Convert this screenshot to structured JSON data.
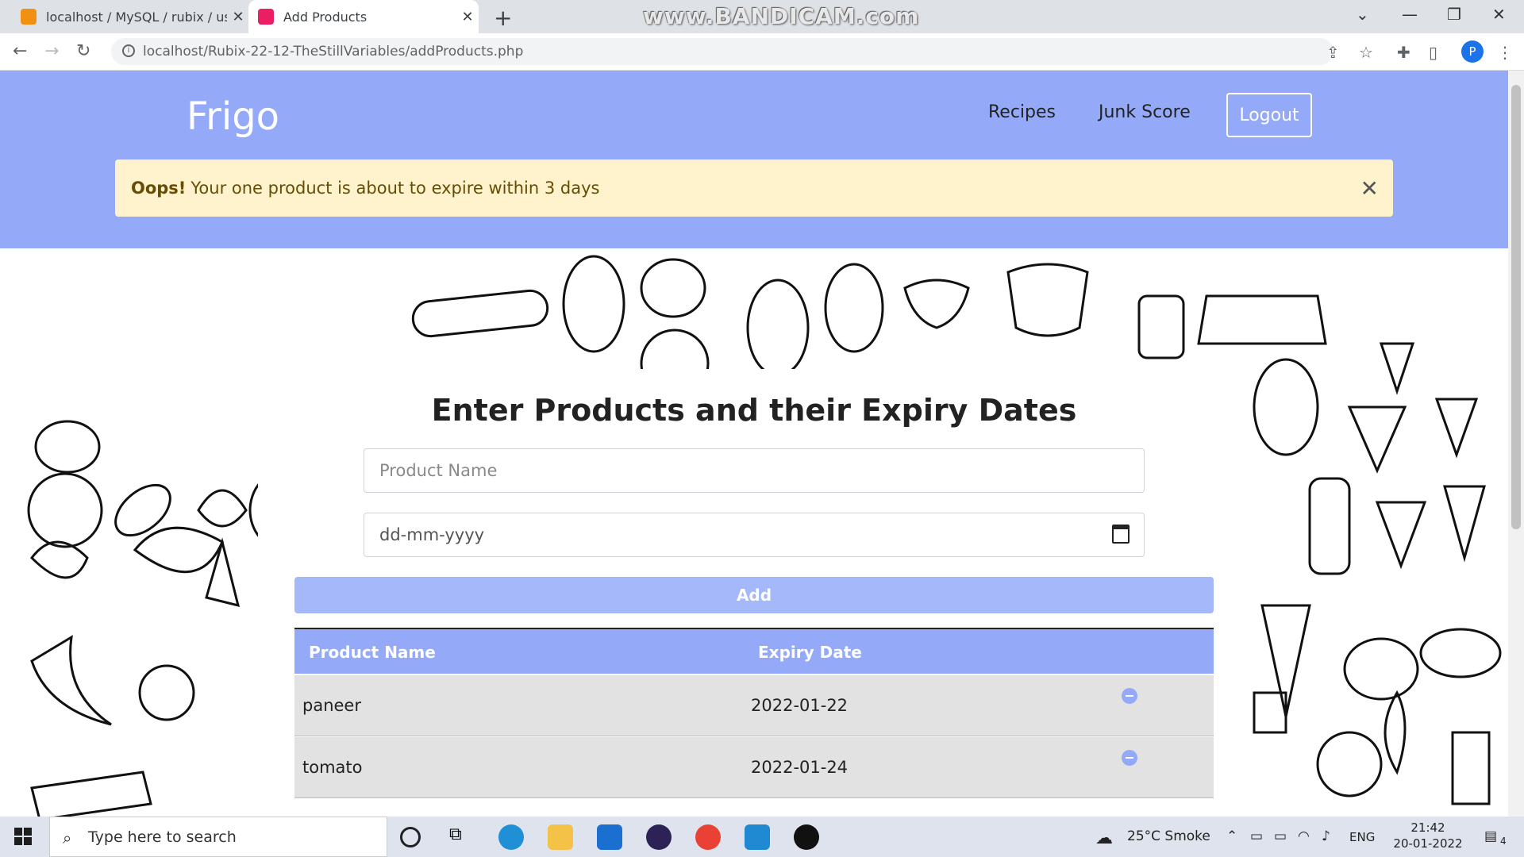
{
  "browser": {
    "tabs": [
      {
        "label": "localhost / MySQL / rubix / users",
        "active": false
      },
      {
        "label": "Add Products",
        "active": true
      }
    ],
    "watermark": "www.BANDICAM.com",
    "url": "localhost/Rubix-22-12-TheStillVariables/addProducts.php",
    "profile_initial": "P"
  },
  "site": {
    "brand": "Frigo",
    "nav": {
      "recipes": "Recipes",
      "junk_score": "Junk Score",
      "logout": "Logout"
    },
    "alert": {
      "strong": "Oops!",
      "message": "Your one product is about to expire within 3 days",
      "close": "✕"
    }
  },
  "form": {
    "title": "Enter Products and their Expiry Dates",
    "product_placeholder": "Product Name",
    "date_placeholder": "dd-mm-yyyy",
    "add_label": "Add"
  },
  "table": {
    "headers": [
      "Product Name",
      "Expiry Date"
    ],
    "rows": [
      {
        "name": "paneer",
        "date": "2022-01-22"
      },
      {
        "name": "tomato",
        "date": "2022-01-24"
      }
    ]
  },
  "taskbar": {
    "search_placeholder": "Type here to search",
    "weather": "25°C  Smoke",
    "lang": "ENG",
    "time": "21:42",
    "date": "20-01-2022",
    "notif_count": "4"
  },
  "colors": {
    "header": "#94aaf8",
    "alert_bg": "#fff3cd",
    "button": "#a4b8fa"
  }
}
